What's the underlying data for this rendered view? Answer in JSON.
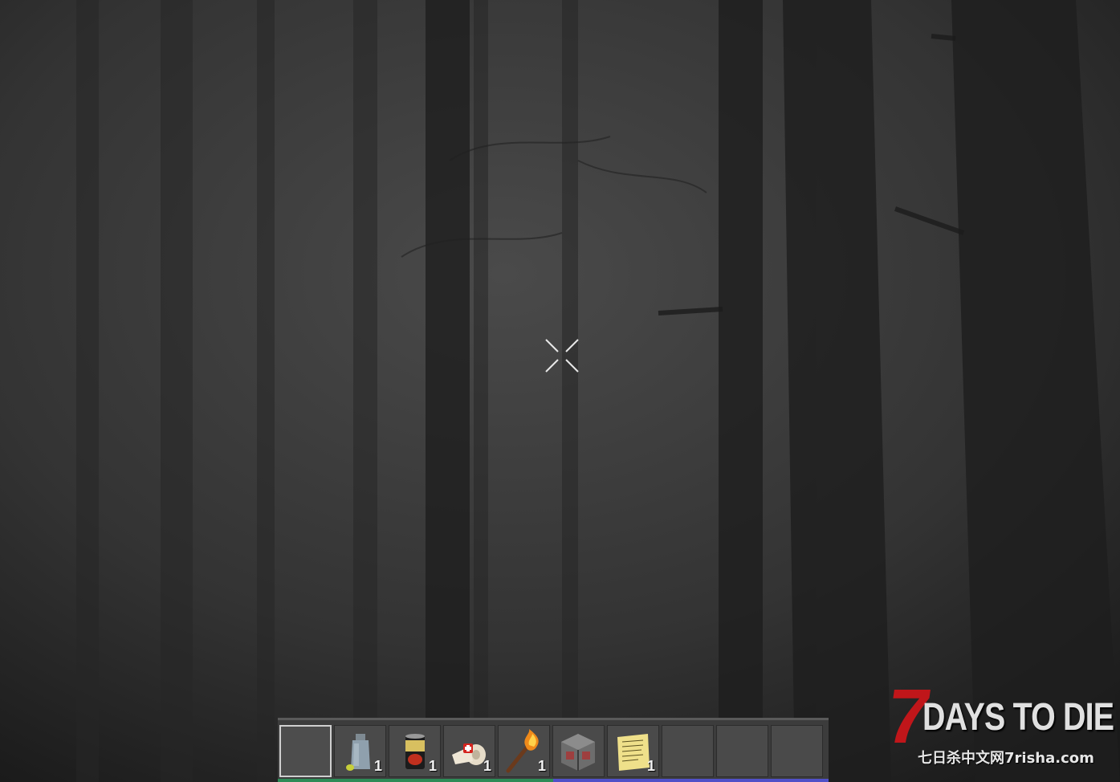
{
  "hud": {
    "crosshair_icon": "crosshair-icon",
    "hotbar": {
      "slots": [
        {
          "icon": "empty",
          "count": ""
        },
        {
          "icon": "water-jar-icon",
          "count": "1"
        },
        {
          "icon": "canned-food-icon",
          "count": "1"
        },
        {
          "icon": "bandage-icon",
          "count": "1"
        },
        {
          "icon": "torch-icon",
          "count": "1"
        },
        {
          "icon": "storage-crate-icon",
          "count": ""
        },
        {
          "icon": "note-icon",
          "count": "1"
        },
        {
          "icon": "empty",
          "count": ""
        },
        {
          "icon": "empty",
          "count": ""
        },
        {
          "icon": "empty",
          "count": ""
        }
      ],
      "selected_slot": 0,
      "colors": {
        "left_bar": "#2e8b57",
        "right_bar": "#5050c8"
      }
    }
  },
  "watermark": {
    "number": "7",
    "title": "DAYS TO DIE",
    "subtitle": "七日杀中文网7risha.com",
    "accent": "#c0161a"
  }
}
